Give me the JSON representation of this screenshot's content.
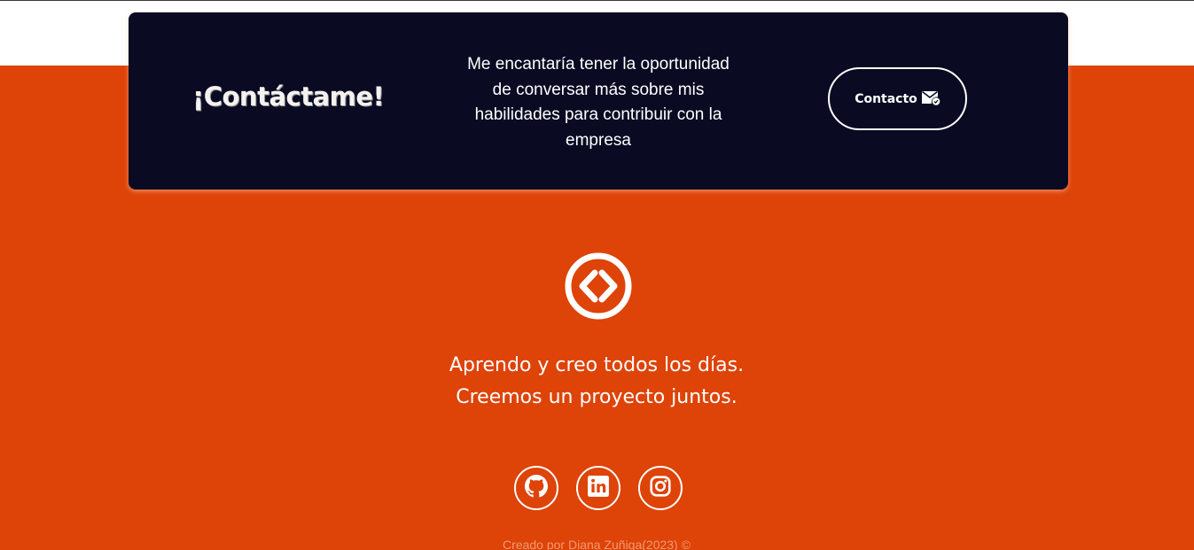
{
  "contact_card": {
    "heading": "¡Contáctame!",
    "text": "Me encantaría tener la oportunidad de conversar más sobre mis habilidades para contribuir con la empresa",
    "button_label": "Contacto",
    "button_icon": "mail-check-icon"
  },
  "footer": {
    "logo_icon": "code-brackets-icon",
    "tagline_line1": "Aprendo y creo todos los días.",
    "tagline_line2": "Creemos un proyecto juntos.",
    "social": [
      {
        "name": "github",
        "icon": "github-icon"
      },
      {
        "name": "linkedin",
        "icon": "linkedin-icon"
      },
      {
        "name": "instagram",
        "icon": "instagram-icon"
      }
    ],
    "credits": "Creado por Diana Zuñiga(2023) ©"
  },
  "colors": {
    "orange_background": "#de4307",
    "card_background": "#0a0b23",
    "text": "#ffffff"
  }
}
